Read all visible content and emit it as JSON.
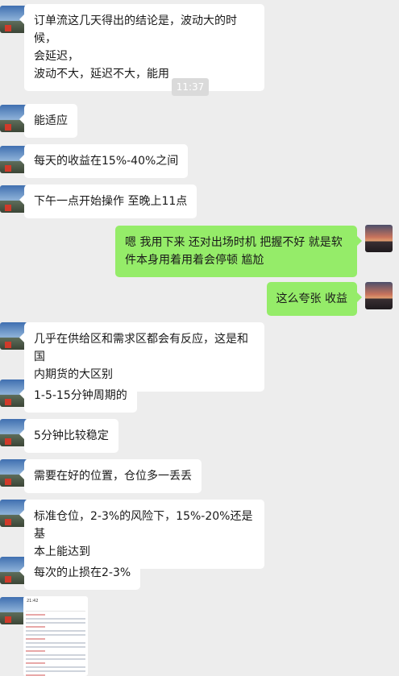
{
  "timestamp": "11:37",
  "messages": [
    {
      "side": "left",
      "text": "订单流这几天得出的结论是，波动大的时候，\n会延迟，\n波动不大，延迟不大，能用"
    },
    {
      "side": "left",
      "text": "能适应"
    },
    {
      "side": "left",
      "text": "每天的收益在15%-40%之间"
    },
    {
      "side": "left",
      "text": "下午一点开始操作 至晚上11点"
    },
    {
      "side": "right",
      "text": "嗯  我用下来 还对出场时机 把握不好   就是软\n件本身用着用着会停顿 尴尬"
    },
    {
      "side": "right",
      "text": "这么夸张 收益"
    },
    {
      "side": "left",
      "text": "几乎在供给区和需求区都会有反应，这是和国\n内期货的大区别"
    },
    {
      "side": "left",
      "text": "1-5-15分钟周期的"
    },
    {
      "side": "left",
      "text": "5分钟比较稳定"
    },
    {
      "side": "left",
      "text": "需要在好的位置，仓位多一丢丢"
    },
    {
      "side": "left",
      "text": "标准仓位，2-3%的风险下，15%-20%还是基\n本上能达到"
    },
    {
      "side": "left",
      "text": "每次的止损在2-3%"
    }
  ],
  "image_message": {
    "side": "left",
    "thumb_time": "21:42"
  },
  "colors": {
    "background": "#ededed",
    "bubble_left": "#ffffff",
    "bubble_right": "#95ec69"
  }
}
